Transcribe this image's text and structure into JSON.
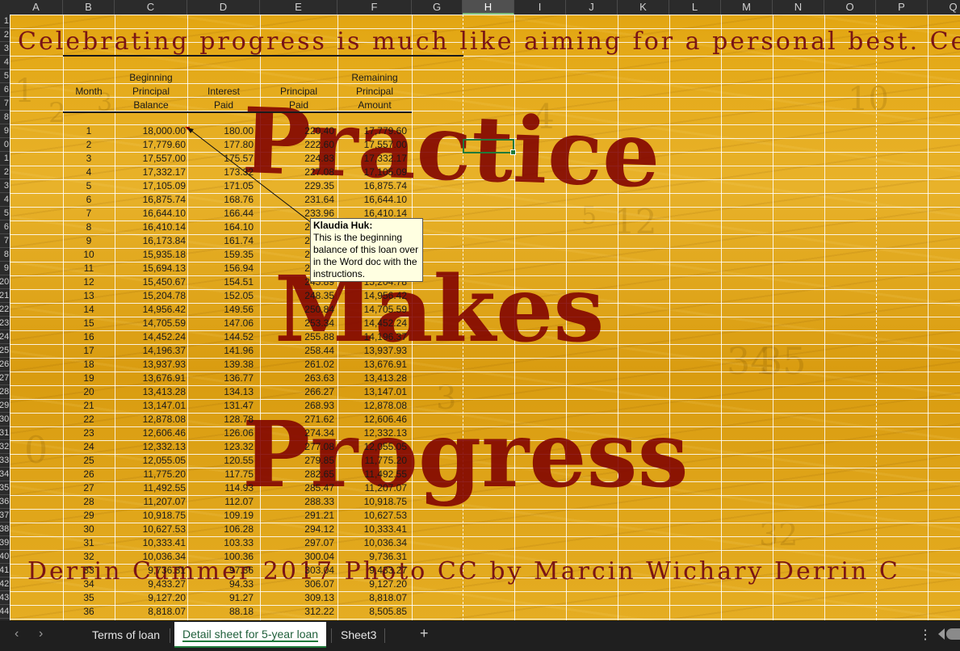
{
  "columns": [
    "A",
    "B",
    "C",
    "D",
    "E",
    "F",
    "G",
    "H",
    "I",
    "J",
    "K",
    "L",
    "M",
    "N",
    "O",
    "P",
    "Q"
  ],
  "selected_column": "H",
  "rows": [
    "1",
    "2",
    "3",
    "4",
    "5",
    "6",
    "7",
    "8",
    "9",
    "0",
    "1",
    "2",
    "3",
    "4",
    "5",
    "6",
    "7",
    "8",
    "9",
    "20",
    "21",
    "22",
    "23",
    "24",
    "25",
    "26",
    "27",
    "28",
    "29",
    "30",
    "31",
    "32",
    "33",
    "34",
    "35",
    "36",
    "37",
    "38",
    "39",
    "40",
    "41",
    "42",
    "43",
    "44"
  ],
  "banner_top": "Celebrating progress is much like aiming for a personal best. Celebrati",
  "banner_bottom": "Derrin Cummer 2017     Photo CC by Marcin Wichary   Derrin C",
  "big_words": [
    "Practice",
    "Makes",
    "Progress"
  ],
  "headers": {
    "month": "Month",
    "beginning": [
      "Beginning",
      "Principal",
      "Balance"
    ],
    "interest": [
      "Interest",
      "Paid"
    ],
    "principal": [
      "Principal",
      "Paid"
    ],
    "remaining": [
      "Remaining",
      "Principal",
      "Amount"
    ]
  },
  "table": [
    [
      "1",
      "18,000.00",
      "180.00",
      "220.40",
      "17,779.60"
    ],
    [
      "2",
      "17,779.60",
      "177.80",
      "222.60",
      "17,557.00"
    ],
    [
      "3",
      "17,557.00",
      "175.57",
      "224.83",
      "17,332.17"
    ],
    [
      "4",
      "17,332.17",
      "173.32",
      "227.08",
      "17,105.09"
    ],
    [
      "5",
      "17,105.09",
      "171.05",
      "229.35",
      "16,875.74"
    ],
    [
      "6",
      "16,875.74",
      "168.76",
      "231.64",
      "16,644.10"
    ],
    [
      "7",
      "16,644.10",
      "166.44",
      "233.96",
      "16,410.14"
    ],
    [
      "8",
      "16,410.14",
      "164.10",
      "236.30",
      "16,173.84"
    ],
    [
      "9",
      "16,173.84",
      "161.74",
      "238.66",
      "15,935.18"
    ],
    [
      "10",
      "15,935.18",
      "159.35",
      "241.05",
      "15,694.13"
    ],
    [
      "11",
      "15,694.13",
      "156.94",
      "243.46",
      "15,450.67"
    ],
    [
      "12",
      "15,450.67",
      "154.51",
      "245.89",
      "15,204.78"
    ],
    [
      "13",
      "15,204.78",
      "152.05",
      "248.35",
      "14,956.42"
    ],
    [
      "14",
      "14,956.42",
      "149.56",
      "250.84",
      "14,705.59"
    ],
    [
      "15",
      "14,705.59",
      "147.06",
      "253.34",
      "14,452.24"
    ],
    [
      "16",
      "14,452.24",
      "144.52",
      "255.88",
      "14,196.37"
    ],
    [
      "17",
      "14,196.37",
      "141.96",
      "258.44",
      "13,937.93"
    ],
    [
      "18",
      "13,937.93",
      "139.38",
      "261.02",
      "13,676.91"
    ],
    [
      "19",
      "13,676.91",
      "136.77",
      "263.63",
      "13,413.28"
    ],
    [
      "20",
      "13,413.28",
      "134.13",
      "266.27",
      "13,147.01"
    ],
    [
      "21",
      "13,147.01",
      "131.47",
      "268.93",
      "12,878.08"
    ],
    [
      "22",
      "12,878.08",
      "128.78",
      "271.62",
      "12,606.46"
    ],
    [
      "23",
      "12,606.46",
      "126.06",
      "274.34",
      "12,332.13"
    ],
    [
      "24",
      "12,332.13",
      "123.32",
      "277.08",
      "12,055.05"
    ],
    [
      "25",
      "12,055.05",
      "120.55",
      "279.85",
      "11,775.20"
    ],
    [
      "26",
      "11,775.20",
      "117.75",
      "282.65",
      "11,492.55"
    ],
    [
      "27",
      "11,492.55",
      "114.93",
      "285.47",
      "11,207.07"
    ],
    [
      "28",
      "11,207.07",
      "112.07",
      "288.33",
      "10,918.75"
    ],
    [
      "29",
      "10,918.75",
      "109.19",
      "291.21",
      "10,627.53"
    ],
    [
      "30",
      "10,627.53",
      "106.28",
      "294.12",
      "10,333.41"
    ],
    [
      "31",
      "10,333.41",
      "103.33",
      "297.07",
      "10,036.34"
    ],
    [
      "32",
      "10,036.34",
      "100.36",
      "300.04",
      "9,736.31"
    ],
    [
      "33",
      "9,736.31",
      "97.36",
      "303.04",
      "9,433.27"
    ],
    [
      "34",
      "9,433.27",
      "94.33",
      "306.07",
      "9,127.20"
    ],
    [
      "35",
      "9,127.20",
      "91.27",
      "309.13",
      "8,818.07"
    ],
    [
      "36",
      "8,818.07",
      "88.18",
      "312.22",
      "8,505.85"
    ]
  ],
  "comment": {
    "author": "Klaudia Huk:",
    "text": "This is the beginning balance of this loan over in the Word doc with the instructions."
  },
  "tabs": [
    "Terms of loan",
    "Detail sheet for 5-year loan",
    "Sheet3"
  ],
  "active_tab": 1,
  "add_sheet": "+",
  "nav_prev": "‹",
  "nav_next": "›",
  "more_menu": "⋮",
  "bg_digits": [
    "1",
    "2",
    "3",
    "4",
    "5",
    "12",
    "34",
    "35",
    "3",
    "32",
    "0",
    "10"
  ]
}
